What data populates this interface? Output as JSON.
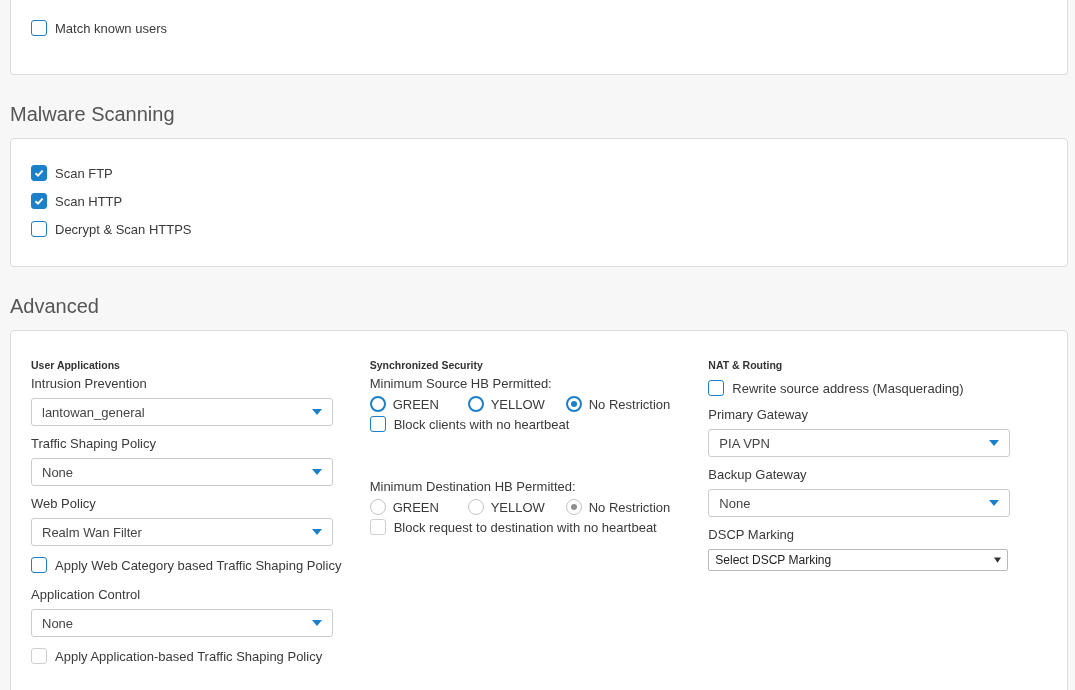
{
  "user_matching": {
    "options": [
      {
        "label": "Match known users",
        "checked": false,
        "disabled": false
      }
    ]
  },
  "malware_scanning": {
    "title": "Malware Scanning",
    "options": [
      {
        "label": "Scan FTP",
        "checked": true,
        "disabled": false
      },
      {
        "label": "Scan HTTP",
        "checked": true,
        "disabled": false
      },
      {
        "label": "Decrypt & Scan HTTPS",
        "checked": false,
        "disabled": false
      }
    ]
  },
  "advanced": {
    "title": "Advanced",
    "columns": [
      {
        "heading": "User Applications",
        "items": [
          {
            "kind": "select",
            "label": "Intrusion Prevention",
            "value": "lantowan_general"
          },
          {
            "kind": "select",
            "label": "Traffic Shaping Policy",
            "value": "None"
          },
          {
            "kind": "select",
            "label": "Web Policy",
            "value": "Realm Wan Filter"
          },
          {
            "kind": "checkbox",
            "label": "Apply Web Category based Traffic Shaping Policy",
            "checked": false,
            "disabled": false
          },
          {
            "kind": "select",
            "label": "Application Control",
            "value": "None"
          },
          {
            "kind": "checkbox",
            "label": "Apply Application-based Traffic Shaping Policy",
            "checked": false,
            "disabled": true
          }
        ]
      },
      {
        "heading": "Synchronized Security",
        "items": [
          {
            "kind": "radio_group",
            "label": "Minimum Source HB Permitted:",
            "disabled": false,
            "options": [
              {
                "label": "GREEN",
                "selected": false
              },
              {
                "label": "YELLOW",
                "selected": false
              },
              {
                "label": "No Restriction",
                "selected": true
              }
            ]
          },
          {
            "kind": "checkbox",
            "label": "Block clients with no heartbeat",
            "checked": false,
            "disabled": false
          },
          {
            "kind": "radio_group",
            "label": "Minimum Destination HB Permitted:",
            "disabled": true,
            "options": [
              {
                "label": "GREEN",
                "selected": false
              },
              {
                "label": "YELLOW",
                "selected": false
              },
              {
                "label": "No Restriction",
                "selected": true
              }
            ]
          },
          {
            "kind": "checkbox",
            "label": "Block request to destination with no heartbeat",
            "checked": false,
            "disabled": true
          }
        ]
      },
      {
        "heading": "NAT & Routing",
        "items": [
          {
            "kind": "checkbox",
            "label": "Rewrite source address (Masquerading)",
            "checked": false,
            "disabled": false
          },
          {
            "kind": "select",
            "label": "Primary Gateway",
            "value": "PIA VPN"
          },
          {
            "kind": "select",
            "label": "Backup Gateway",
            "value": "None"
          },
          {
            "kind": "native_select",
            "label": "DSCP Marking",
            "value": "Select DSCP Marking"
          }
        ]
      }
    ]
  }
}
